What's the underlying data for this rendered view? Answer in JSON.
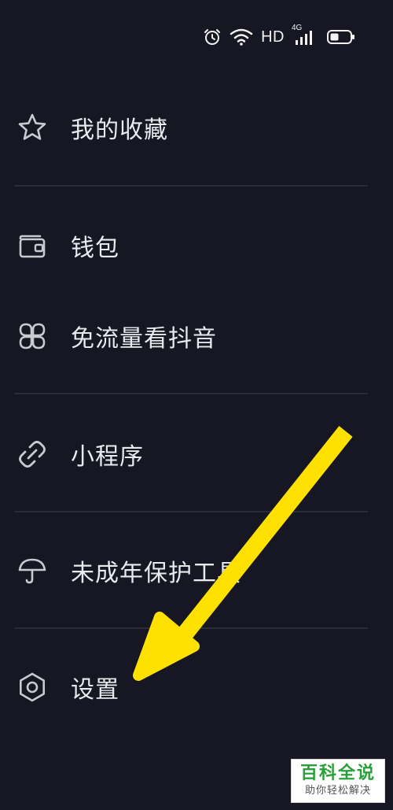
{
  "status_bar": {
    "network_label": "HD",
    "signal_label": "4G",
    "icons": [
      "alarm-icon",
      "wifi-icon",
      "signal-icon",
      "battery-icon"
    ]
  },
  "menu": {
    "items": [
      {
        "label": "我的收藏",
        "icon": "star-icon"
      },
      {
        "label": "钱包",
        "icon": "wallet-icon"
      },
      {
        "label": "免流量看抖音",
        "icon": "grid-flower-icon"
      },
      {
        "label": "小程序",
        "icon": "link-icon"
      },
      {
        "label": "未成年保护工具",
        "icon": "umbrella-icon"
      },
      {
        "label": "设置",
        "icon": "gear-icon"
      }
    ]
  },
  "annotation": {
    "arrow_color": "#ffe100"
  },
  "watermark": {
    "title": "百科全说",
    "subtitle": "助你轻松解决"
  },
  "colors": {
    "background": "#161722",
    "text": "#e9eaee",
    "divider": "#2b2c37",
    "watermark_green": "#2aa03b"
  }
}
